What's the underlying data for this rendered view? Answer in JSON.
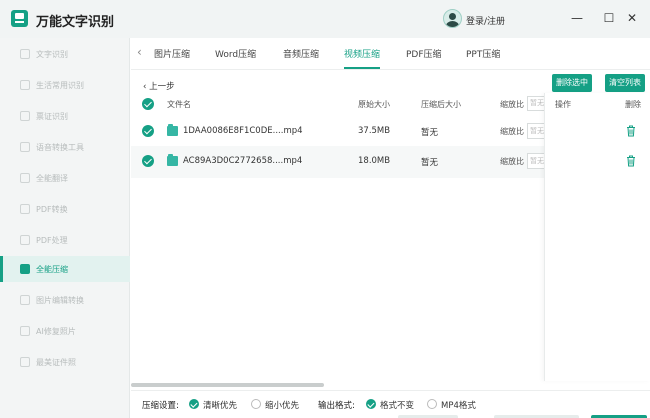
{
  "app": {
    "title": "万能文字识别",
    "login": "登录/注册"
  },
  "window": {
    "minimize": "—",
    "maximize": "☐",
    "close": "✕"
  },
  "sidebar": {
    "items": [
      {
        "label": "文字识别"
      },
      {
        "label": "生活常用识别"
      },
      {
        "label": "票证识别"
      },
      {
        "label": "语音转换工具"
      },
      {
        "label": "全能翻译"
      },
      {
        "label": "PDF转换"
      },
      {
        "label": "PDF处理"
      },
      {
        "label": "全能压缩"
      },
      {
        "label": "图片编辑转换"
      },
      {
        "label": "AI修复照片"
      },
      {
        "label": "最美证件照"
      }
    ],
    "active_index": 7
  },
  "tabs": {
    "back": "‹",
    "items": [
      {
        "label": "图片压缩"
      },
      {
        "label": "Word压缩"
      },
      {
        "label": "音频压缩"
      },
      {
        "label": "视频压缩"
      },
      {
        "label": "PDF压缩"
      },
      {
        "label": "PPT压缩"
      }
    ],
    "active_index": 3
  },
  "toolbar": {
    "prev_step": "上一步",
    "delete_selected": "删除选中",
    "clear_list": "清空列表"
  },
  "table": {
    "headers": {
      "filename": "文件名",
      "original_size": "原始大小",
      "compressed_size": "压缩后大小",
      "ratio": "缩放比",
      "ratio_placeholder": "暂无",
      "actions": "操作",
      "delete": "删除"
    },
    "rows": [
      {
        "filename": "1DAA0086E8F1C0DE....mp4",
        "original_size": "37.5MB",
        "compressed_size": "暂无",
        "ratio_label": "缩放比",
        "ratio_value": "暂无"
      },
      {
        "filename": "AC89A3D0C2772658....mp4",
        "original_size": "18.0MB",
        "compressed_size": "暂无",
        "ratio_label": "缩放比",
        "ratio_value": "暂无"
      }
    ]
  },
  "settings": {
    "compress_label": "压缩设置:",
    "compress_options": [
      {
        "label": "清晰优先",
        "selected": true
      },
      {
        "label": "缩小优先",
        "selected": false
      }
    ],
    "output_label": "输出格式:",
    "output_options": [
      {
        "label": "格式不变",
        "selected": true
      },
      {
        "label": "MP4格式",
        "selected": false
      }
    ]
  },
  "colors": {
    "accent": "#15a085"
  }
}
